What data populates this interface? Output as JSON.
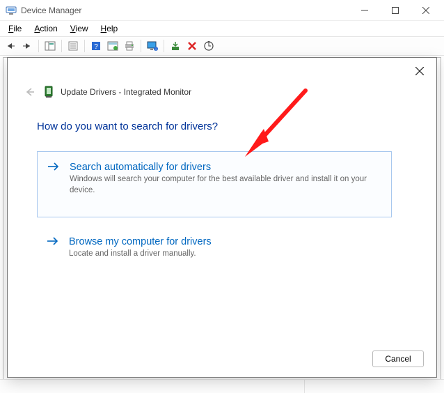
{
  "window": {
    "title": "Device Manager"
  },
  "menubar": {
    "items": [
      "File",
      "Action",
      "View",
      "Help"
    ]
  },
  "toolbar_icons": [
    "back-arrow-icon",
    "forward-arrow-icon",
    "show-hide-tree-icon",
    "properties-icon",
    "help-icon",
    "update-driver-icon",
    "print-icon",
    "monitor-info-icon",
    "install-icon",
    "delete-icon",
    "scan-hardware-icon"
  ],
  "dialog": {
    "back_enabled": false,
    "title": "Update Drivers - Integrated Monitor",
    "heading": "How do you want to search for drivers?",
    "option1": {
      "title": "Search automatically for drivers",
      "desc": "Windows will search your computer for the best available driver and install it on your device."
    },
    "option2": {
      "title": "Browse my computer for drivers",
      "desc": "Locate and install a driver manually."
    },
    "cancel_label": "Cancel"
  }
}
